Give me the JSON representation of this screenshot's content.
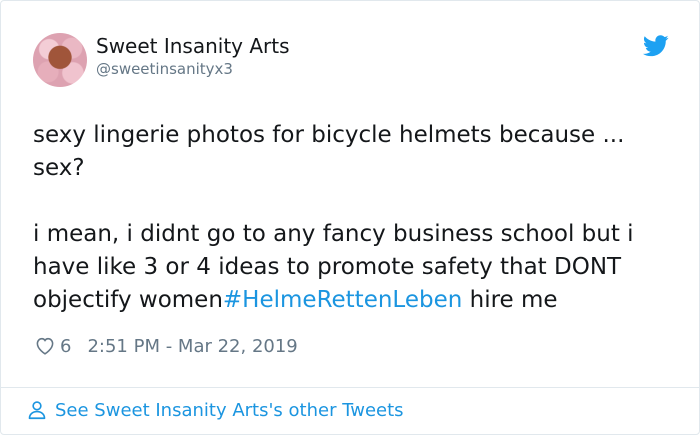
{
  "author": {
    "name": "Sweet Insanity Arts",
    "handle": "@sweetinsanityx3"
  },
  "tweet": {
    "text_part1": "sexy lingerie photos for bicycle helmets because ... sex?\n\ni mean, i didnt go to any fancy business school but i have like 3 or 4 ideas to promote safety that DONT objectify women",
    "hashtag": "#HelmeRettenLeben",
    "text_part2": " hire me"
  },
  "meta": {
    "likes": "6",
    "timestamp": "2:51 PM - Mar 22, 2019"
  },
  "footer": {
    "see_more_label": "See Sweet Insanity Arts's other Tweets"
  },
  "icons": {
    "logo": "twitter-bird-icon",
    "like": "heart-icon",
    "profile": "person-icon"
  },
  "colors": {
    "link": "#1b95e0",
    "secondary_text": "#657786",
    "border": "#e1e8ed"
  }
}
